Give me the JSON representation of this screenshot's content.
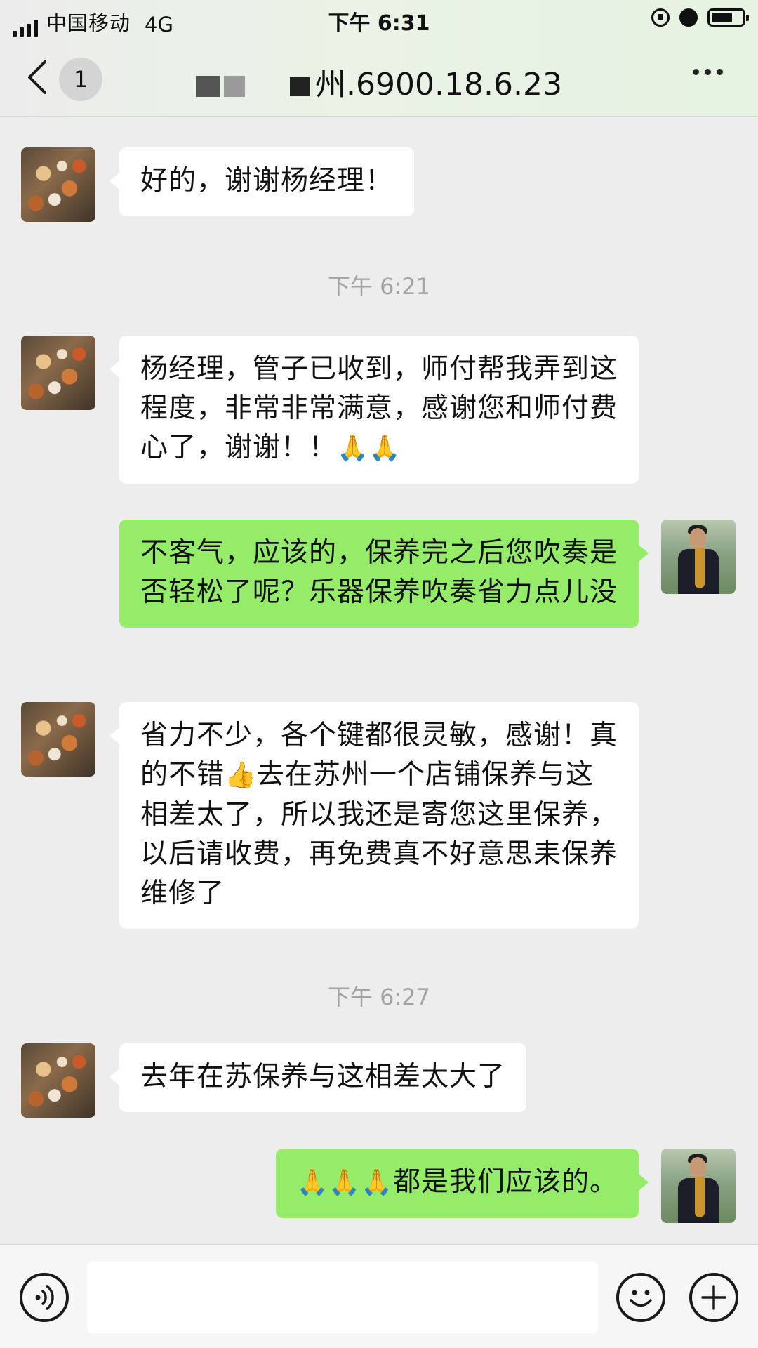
{
  "status_bar": {
    "carrier": "中国移动",
    "network": "4G",
    "time": "下午 6:31",
    "icons": [
      "signal-icon",
      "rotation-lock-icon",
      "alarm-icon",
      "battery-icon"
    ]
  },
  "nav": {
    "unread_count": "1",
    "title": "州.6900.18.6.23",
    "icons": [
      "back-icon",
      "more-icon"
    ]
  },
  "messages": [
    {
      "sender": "other",
      "text": "好的，谢谢杨经理！"
    },
    {
      "sender": "other",
      "text": "杨经理，管子已收到，师付帮我弄到这程度，非常非常满意，感谢您和师付费心了，谢谢！！",
      "emoji": "🙏🙏"
    },
    {
      "sender": "self",
      "text": "不客气，应该的，保养完之后您吹奏是否轻松了呢？乐器保养吹奏省力点儿没"
    },
    {
      "sender": "other",
      "text_a": "省力不少，各个键都很灵敏，感谢！真的不错",
      "emoji": "👍",
      "text_b": "去在苏州一个店铺保养与这相差太了，所以我还是寄您这里保养，以后请收费，再免费真不好意思耒保养维修了"
    },
    {
      "sender": "other",
      "text": "去年在苏保养与这相差太大了"
    },
    {
      "sender": "self",
      "emoji": "🙏🙏🙏",
      "text": "都是我们应该的。"
    }
  ],
  "timestamps": [
    "下午 6:21",
    "下午 6:27"
  ],
  "input_bar": {
    "placeholder": "",
    "icons": [
      "voice-icon",
      "emoji-icon",
      "plus-icon"
    ]
  },
  "colors": {
    "chat_background": "#ededed",
    "incoming_bubble": "#ffffff",
    "outgoing_bubble": "#95ec69",
    "timestamp_text": "#a3a3a3"
  }
}
